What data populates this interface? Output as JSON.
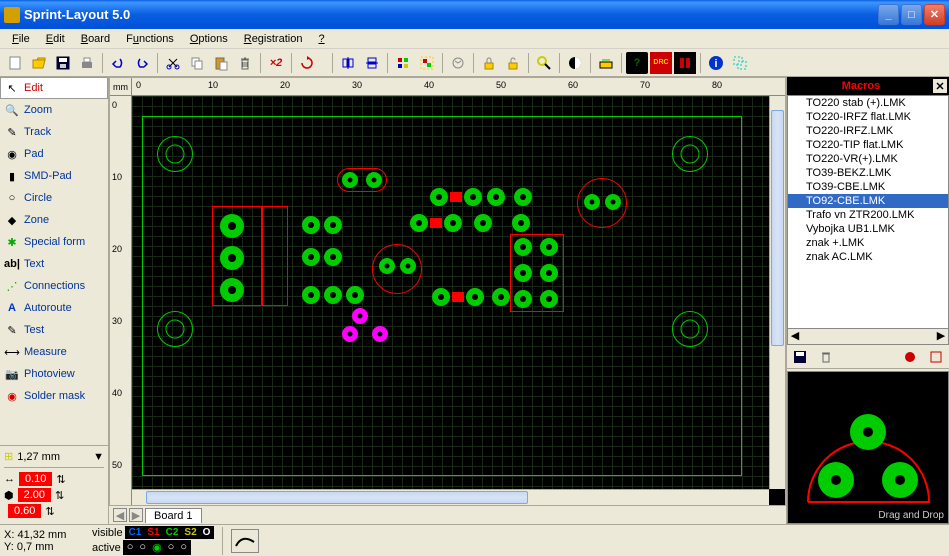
{
  "window": {
    "title": "Sprint-Layout 5.0"
  },
  "menu": {
    "file": "File",
    "edit": "Edit",
    "board": "Board",
    "functions": "Functions",
    "options": "Options",
    "registration": "Registration",
    "help": "?"
  },
  "tools": {
    "edit": "Edit",
    "zoom": "Zoom",
    "track": "Track",
    "pad": "Pad",
    "smdpad": "SMD-Pad",
    "circle": "Circle",
    "zone": "Zone",
    "specialform": "Special form",
    "text": "Text",
    "connections": "Connections",
    "autoroute": "Autoroute",
    "test": "Test",
    "measure": "Measure",
    "photoview": "Photoview",
    "soldermask": "Solder mask"
  },
  "grid": {
    "value": "1,27 mm"
  },
  "track_width": "0.10",
  "pad_size": "2.00",
  "drill_size": "0.60",
  "ruler_unit": "mm",
  "ruler_marks_h": [
    "0",
    "10",
    "20",
    "30",
    "40",
    "50",
    "60",
    "70",
    "80"
  ],
  "ruler_marks_v": [
    "0",
    "10",
    "20",
    "30",
    "40",
    "50"
  ],
  "tab": "Board 1",
  "status": {
    "x_label": "X:",
    "x": "41,32 mm",
    "y_label": "Y:",
    "y": "0,7 mm",
    "visible": "visible",
    "active": "active",
    "layers": {
      "c1": "C1",
      "s1": "S1",
      "c2": "C2",
      "s2": "S2",
      "o": "O"
    }
  },
  "macros": {
    "title": "Macros",
    "items": [
      "TO220 stab (+).LMK",
      "TO220-IRFZ flat.LMK",
      "TO220-IRFZ.LMK",
      "TO220-TIP flat.LMK",
      "TO220-VR(+).LMK",
      "TO39-BEKZ.LMK",
      "TO39-CBE.LMK",
      "TO92-CBE.LMK",
      "Trafo vn ZTR200.LMK",
      "Vybojka UB1.LMK",
      "znak +.LMK",
      "znak AC.LMK"
    ],
    "selected_index": 7,
    "dragdrop": "Drag and Drop"
  }
}
